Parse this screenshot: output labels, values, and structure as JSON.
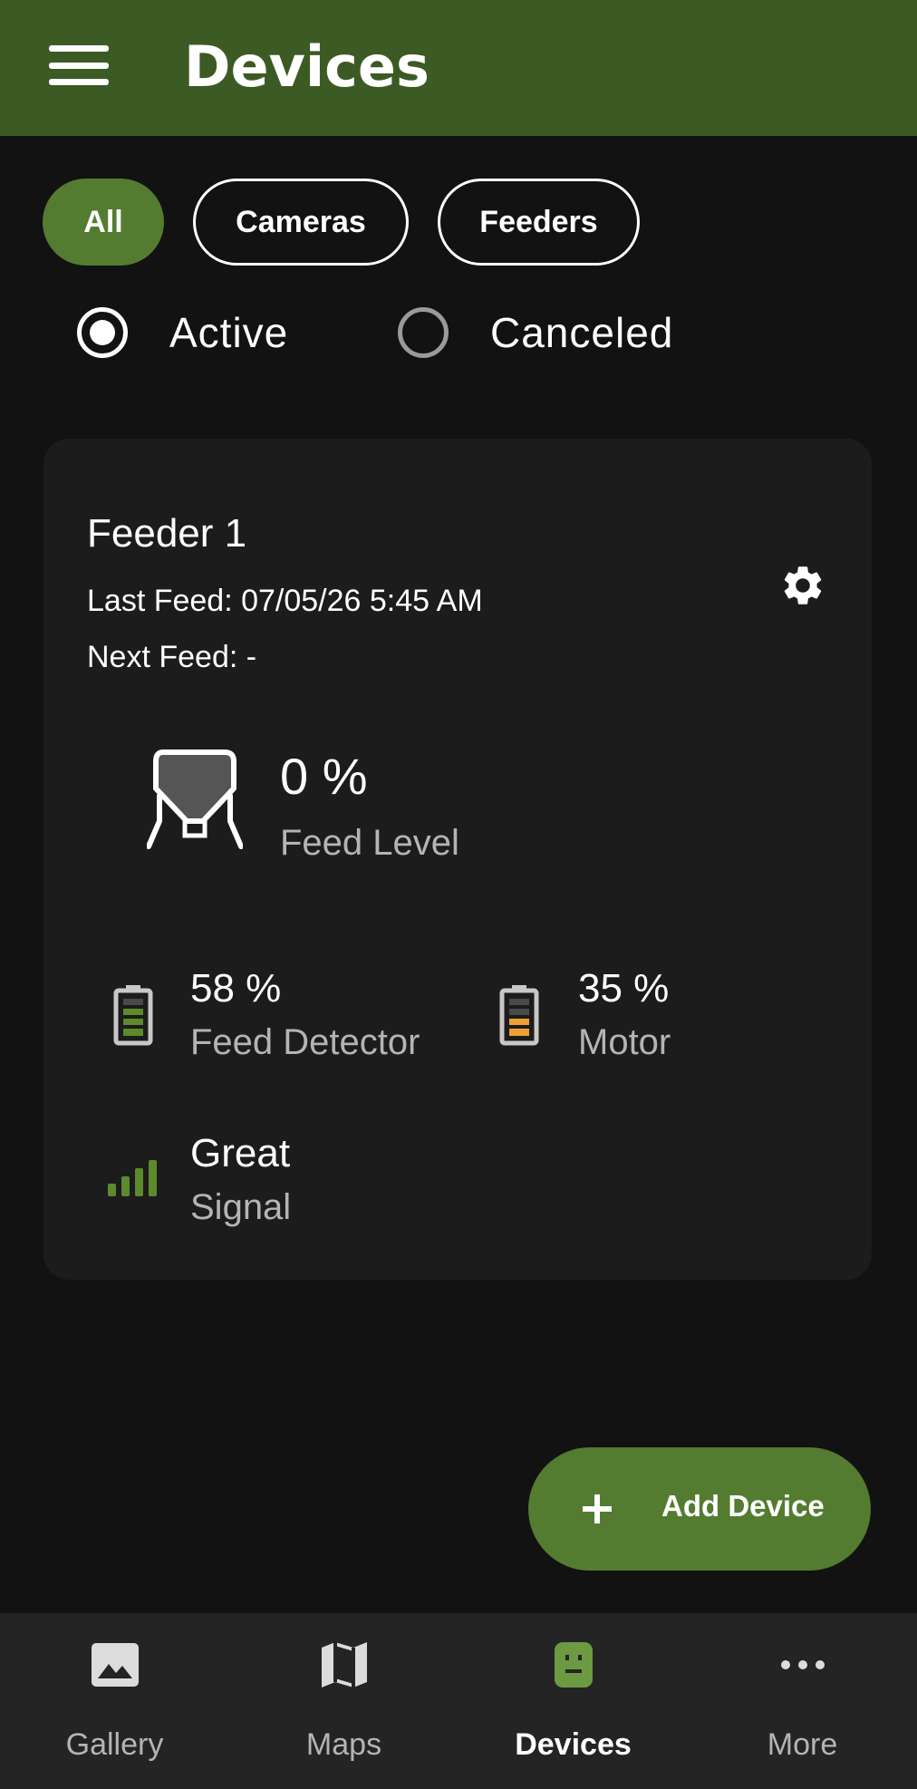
{
  "app_bar": {
    "title": "Devices",
    "menu_icon": "menu-icon"
  },
  "filters": {
    "all": "All",
    "cameras": "Cameras",
    "feeders": "Feeders",
    "selected": "All"
  },
  "status": {
    "active": "Active",
    "canceled": "Canceled",
    "selected": "Active"
  },
  "device": {
    "name": "Feeder 1",
    "last_feed": "Last Feed: 07/05/26 5:45 AM",
    "next_feed": "Next Feed: -",
    "settings_icon": "gear-icon",
    "feed_level": {
      "value": "0 %",
      "label": "Feed Level",
      "fraction": 0.0
    },
    "feed_detector": {
      "value": "58 %",
      "label": "Feed Detector",
      "fraction": 0.58
    },
    "motor": {
      "value": "35 %",
      "label": "Motor",
      "fraction": 0.35
    },
    "signal": {
      "value": "Great",
      "label": "Signal",
      "bars": 4
    }
  },
  "fab": {
    "label": "Add Device",
    "icon": "plus-icon"
  },
  "bottom_nav": {
    "items": [
      {
        "label": "Gallery",
        "icon": "image-icon"
      },
      {
        "label": "Maps",
        "icon": "map-icon"
      },
      {
        "label": "Devices",
        "icon": "device-icon"
      },
      {
        "label": "More",
        "icon": "more-icon"
      }
    ],
    "active": "Devices"
  },
  "colors": {
    "brand": "#3b5a24",
    "accent": "#537c30",
    "battery_good": "#5c8a2c",
    "battery_mid": "#f0a030"
  }
}
